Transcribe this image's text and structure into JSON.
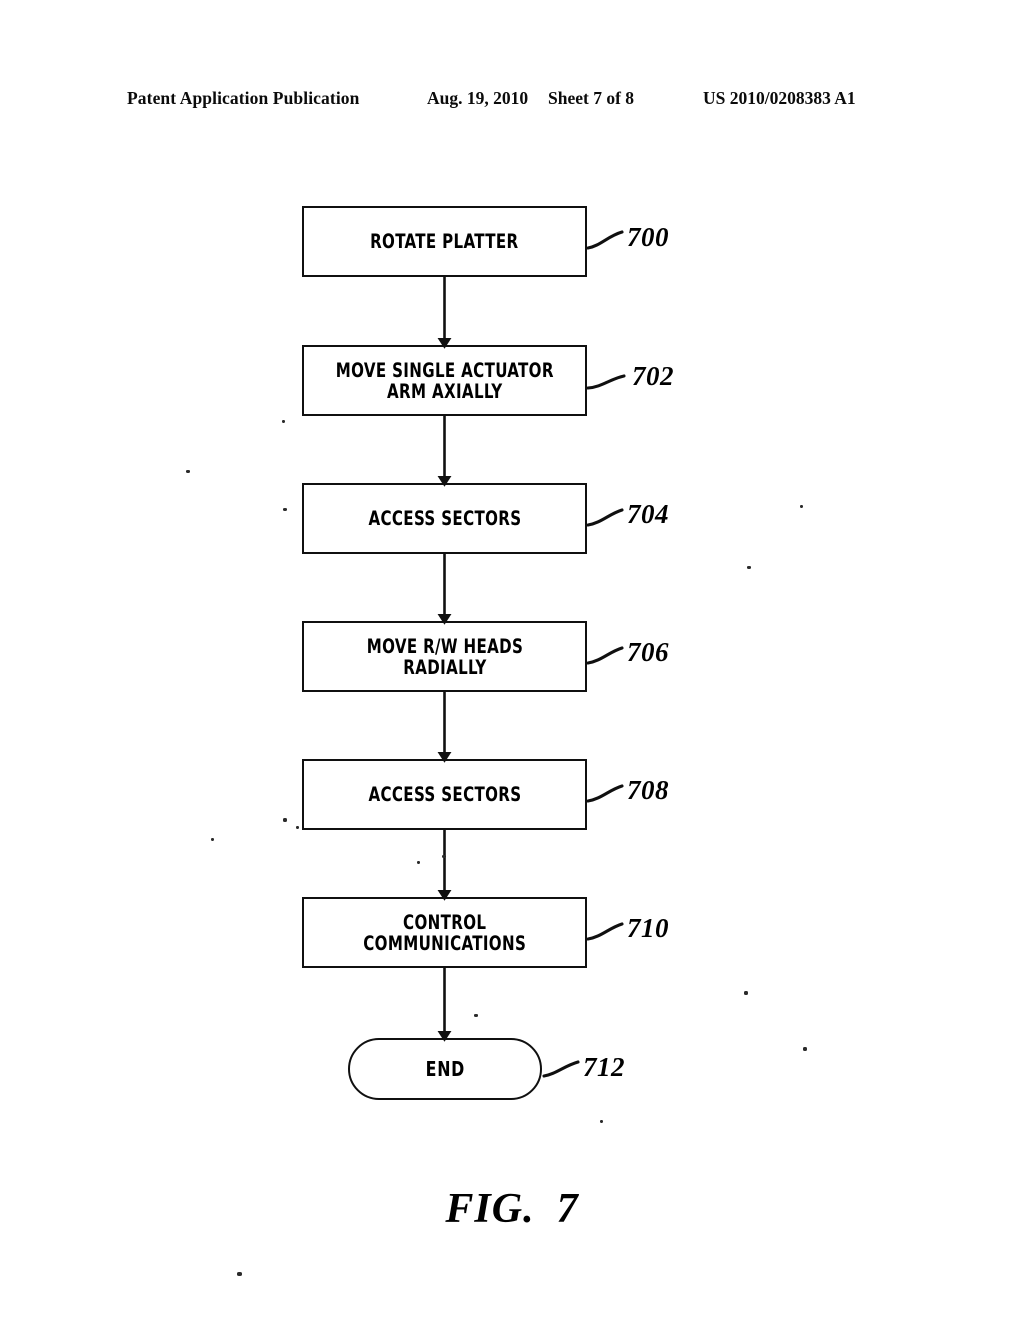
{
  "header": {
    "publication": "Patent Application Publication",
    "date": "Aug. 19, 2010",
    "sheet": "Sheet 7 of 8",
    "doc_number": "US 2010/0208383 A1"
  },
  "figure": {
    "caption_word": "FIG.",
    "caption_number": "7"
  },
  "chart_data": {
    "type": "diagram",
    "diagram_kind": "flowchart",
    "orientation": "vertical",
    "title": "FIG. 7",
    "nodes": [
      {
        "id": "700",
        "label": "ROTATE PLATTER",
        "shape": "rectangle",
        "ref": "700"
      },
      {
        "id": "702",
        "label": "MOVE SINGLE ACTUATOR\nARM AXIALLY",
        "shape": "rectangle",
        "ref": "702"
      },
      {
        "id": "704",
        "label": "ACCESS SECTORS",
        "shape": "rectangle",
        "ref": "704"
      },
      {
        "id": "706",
        "label": "MOVE R/W HEADS\nRADIALLY",
        "shape": "rectangle",
        "ref": "706"
      },
      {
        "id": "708",
        "label": "ACCESS SECTORS",
        "shape": "rectangle",
        "ref": "708"
      },
      {
        "id": "710",
        "label": "CONTROL\nCOMMUNICATIONS",
        "shape": "rectangle",
        "ref": "710"
      },
      {
        "id": "712",
        "label": "END",
        "shape": "stadium",
        "ref": "712"
      }
    ],
    "edges": [
      {
        "from": "700",
        "to": "702",
        "arrow": true
      },
      {
        "from": "702",
        "to": "704",
        "arrow": true
      },
      {
        "from": "704",
        "to": "706",
        "arrow": true
      },
      {
        "from": "706",
        "to": "708",
        "arrow": true
      },
      {
        "from": "708",
        "to": "710",
        "arrow": true
      },
      {
        "from": "710",
        "to": "712",
        "arrow": true
      }
    ],
    "colors": {
      "stroke": "#101010",
      "fill": "#ffffff",
      "text": "#000000"
    }
  }
}
